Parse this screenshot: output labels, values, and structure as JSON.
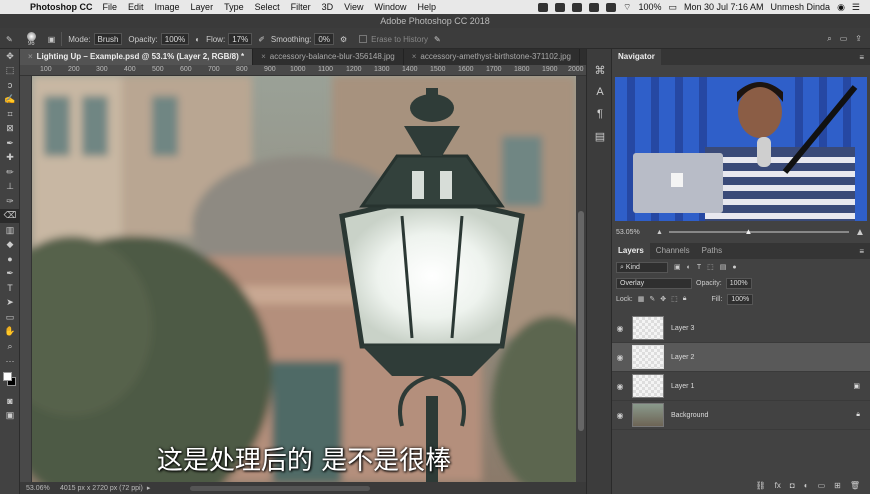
{
  "menubar": {
    "app_name": "Photoshop CC",
    "items": [
      "File",
      "Edit",
      "Image",
      "Layer",
      "Type",
      "Select",
      "Filter",
      "3D",
      "View",
      "Window",
      "Help"
    ],
    "battery": "100%",
    "datetime": "Mon 30 Jul  7:16 AM",
    "user": "Unmesh Dinda"
  },
  "window_title": "Adobe Photoshop CC 2018",
  "options": {
    "brush_size": "96",
    "mode_label": "Mode:",
    "mode_value": "Brush",
    "opacity_label": "Opacity:",
    "opacity_value": "100%",
    "flow_label": "Flow:",
    "flow_value": "17%",
    "smoothing_label": "Smoothing:",
    "smoothing_value": "0%",
    "erase_history": "Erase to History"
  },
  "doc_tabs": [
    {
      "label": "Lighting Up – Example.psd @ 53.1% (Layer 2, RGB/8) *"
    },
    {
      "label": "accessory-balance-blur-356148.jpg"
    },
    {
      "label": "accessory-amethyst-birthstone-371102.jpg"
    }
  ],
  "ruler_ticks": [
    "100",
    "200",
    "300",
    "400",
    "500",
    "600",
    "700",
    "800",
    "900",
    "1000",
    "1100",
    "1200",
    "1300",
    "1400",
    "1500",
    "1600",
    "1700",
    "1800",
    "1900",
    "2000"
  ],
  "subtitle": "这是处理后的 是不是很棒",
  "status": {
    "zoom": "53.06%",
    "doc_size": "4015 px x 2720 px (72 ppi)"
  },
  "navigator": {
    "title": "Navigator",
    "zoom": "53.05%"
  },
  "layers_panel": {
    "tabs": [
      "Layers",
      "Channels",
      "Paths"
    ],
    "filter_kind": "Kind",
    "blend_mode": "Overlay",
    "opacity_label": "Opacity:",
    "opacity_value": "100%",
    "lock_label": "Lock:",
    "fill_label": "Fill:",
    "fill_value": "100%",
    "layers": [
      {
        "name": "Layer 3"
      },
      {
        "name": "Layer 2"
      },
      {
        "name": "Layer 1"
      },
      {
        "name": "Background"
      }
    ]
  }
}
